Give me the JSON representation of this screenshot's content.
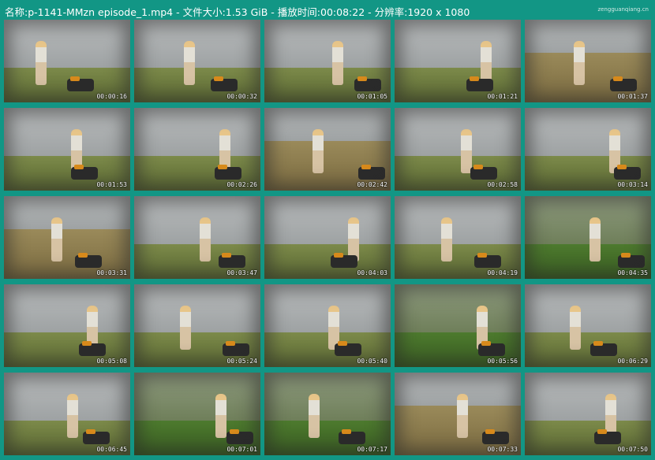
{
  "header": {
    "text": "名称:p-1141-MMzn episode_1.mp4 - 文件大小:1.53 GiB - 播放时间:00:08:22 - 分辨率:1920 x 1080"
  },
  "watermark": "zengguanqiang.cn",
  "thumbnails": [
    {
      "time": "00:00:16",
      "style": "plain"
    },
    {
      "time": "00:00:32",
      "style": "plain"
    },
    {
      "time": "00:01:05",
      "style": "plain"
    },
    {
      "time": "00:01:21",
      "style": "plain"
    },
    {
      "time": "00:01:37",
      "style": "dry"
    },
    {
      "time": "00:01:53",
      "style": "plain"
    },
    {
      "time": "00:02:26",
      "style": "plain"
    },
    {
      "time": "00:02:42",
      "style": "dry"
    },
    {
      "time": "00:02:58",
      "style": "plain"
    },
    {
      "time": "00:03:14",
      "style": "plain"
    },
    {
      "time": "00:03:31",
      "style": "dry"
    },
    {
      "time": "00:03:47",
      "style": "plain"
    },
    {
      "time": "00:04:03",
      "style": "plain"
    },
    {
      "time": "00:04:19",
      "style": "plain"
    },
    {
      "time": "00:04:35",
      "style": "green"
    },
    {
      "time": "00:05:08",
      "style": "plain"
    },
    {
      "time": "00:05:24",
      "style": "plain"
    },
    {
      "time": "00:05:40",
      "style": "plain"
    },
    {
      "time": "00:05:56",
      "style": "green"
    },
    {
      "time": "00:06:29",
      "style": "plain"
    },
    {
      "time": "00:06:45",
      "style": "plain"
    },
    {
      "time": "00:07:01",
      "style": "green"
    },
    {
      "time": "00:07:17",
      "style": "green"
    },
    {
      "time": "00:07:33",
      "style": "dry"
    },
    {
      "time": "00:07:50",
      "style": "plain"
    }
  ]
}
